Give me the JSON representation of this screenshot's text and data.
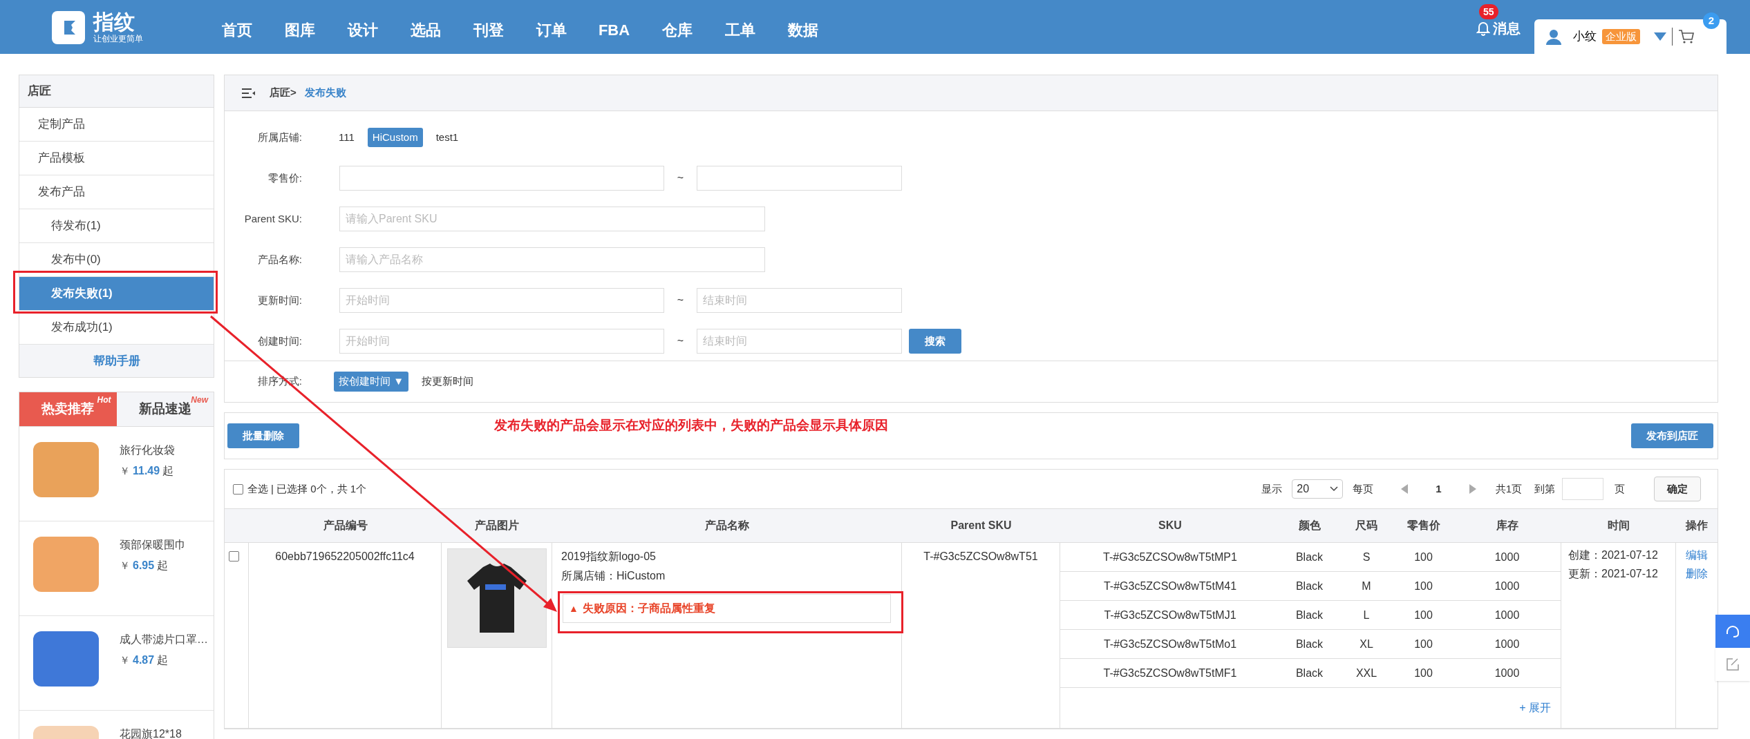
{
  "header": {
    "logo_title": "指纹",
    "logo_slogan": "让创业更简单",
    "nav": [
      {
        "label": "首页"
      },
      {
        "label": "图库"
      },
      {
        "label": "设计"
      },
      {
        "label": "选品"
      },
      {
        "label": "刊登"
      },
      {
        "label": "订单"
      },
      {
        "label": "FBA"
      },
      {
        "label": "仓库"
      },
      {
        "label": "工单"
      },
      {
        "label": "数据"
      }
    ],
    "messages": {
      "label": "消息",
      "count": "55"
    },
    "user": {
      "name": "小纹",
      "badge": "企业版"
    },
    "cart_count": "2"
  },
  "sidebar": {
    "title": "店匠",
    "items": [
      {
        "label": "定制产品",
        "selected": false
      },
      {
        "label": "产品模板",
        "selected": false
      },
      {
        "label": "发布产品",
        "selected": false,
        "children": [
          {
            "label": "待发布(1)",
            "selected": false
          },
          {
            "label": "发布中(0)",
            "selected": false
          },
          {
            "label": "发布失败(1)",
            "selected": true
          },
          {
            "label": "发布成功(1)",
            "selected": false
          }
        ]
      }
    ],
    "help": "帮助手册",
    "tabs": [
      {
        "label": "热卖推荐",
        "tag": "Hot",
        "selected": true
      },
      {
        "label": "新品速递",
        "tag": "New",
        "selected": false
      }
    ],
    "products": [
      {
        "name": "旅行化妆袋",
        "currency": "￥",
        "price": "11.49",
        "suffix": "起",
        "color": "#e9a25a"
      },
      {
        "name": "颈部保暖围巾",
        "currency": "￥",
        "price": "6.95",
        "suffix": "起",
        "color": "#f0a564"
      },
      {
        "name": "成人带滤片口罩…",
        "currency": "￥",
        "price": "4.87",
        "suffix": "起",
        "color": "#3f78d8"
      },
      {
        "name": "花园旗12*18",
        "color": "#f6d3b4"
      }
    ]
  },
  "breadcrumb": {
    "parent": "店匠>",
    "current": "发布失败"
  },
  "filters": {
    "store": {
      "label": "所属店铺:",
      "options": [
        {
          "label": "111",
          "selected": false
        },
        {
          "label": "HiCustom",
          "selected": true
        },
        {
          "label": "test1",
          "selected": false
        }
      ]
    },
    "price": {
      "label": "零售价:",
      "separator": "~"
    },
    "parent_sku": {
      "label": "Parent SKU:",
      "placeholder": "请输入Parent SKU"
    },
    "product_name": {
      "label": "产品名称:",
      "placeholder": "请输入产品名称"
    },
    "updated": {
      "label": "更新时间:",
      "from_placeholder": "开始时间",
      "separator": "~",
      "to_placeholder": "结束时间"
    },
    "created": {
      "label": "创建时间:",
      "from_placeholder": "开始时间",
      "separator": "~",
      "to_placeholder": "结束时间"
    },
    "search_button": "搜索",
    "sort": {
      "label": "排序方式:",
      "options": [
        {
          "label": "按创建时间",
          "arrow": "▼",
          "selected": true
        },
        {
          "label": "按更新时间",
          "selected": false
        }
      ]
    }
  },
  "toolbar": {
    "batch_delete": "批量删除",
    "publish": "发布到店匠"
  },
  "annotation": "发布失败的产品会显示在对应的列表中，失败的产品会显示具体原因",
  "list": {
    "select_all": {
      "label": "全选",
      "checked": false
    },
    "summary": "| 已选择 0个，共 1个",
    "pagination": {
      "show": "显示",
      "page_size": "20",
      "per_page": "每页",
      "current": "1",
      "total": "共1页",
      "goto": "到第",
      "page": "页",
      "confirm": "确定"
    },
    "columns": [
      "产品编号",
      "产品图片",
      "产品名称",
      "Parent SKU",
      "SKU",
      "颜色",
      "尺码",
      "零售价",
      "库存",
      "时间",
      "操作"
    ],
    "rows": [
      {
        "checked": false,
        "id": "60ebb719652205002ffc11c4",
        "name": "2019指纹新logo-05",
        "store": "所属店铺：HiCustom",
        "error_icon": "▲",
        "error": "失败原因：子商品属性重复",
        "parent_sku": "T-#G3c5ZCSOw8wT51",
        "variants": [
          {
            "sku": "T-#G3c5ZCSOw8wT5tMP1",
            "color_label": "Black",
            "size": "S",
            "price": "100",
            "stock": "1000"
          },
          {
            "sku": "T-#G3c5ZCSOw8wT5tM41",
            "color_label": "Black",
            "size": "M",
            "price": "100",
            "stock": "1000"
          },
          {
            "sku": "T-#G3c5ZCSOw8wT5tMJ1",
            "color_label": "Black",
            "size": "L",
            "price": "100",
            "stock": "1000"
          },
          {
            "sku": "T-#G3c5ZCSOw8wT5tMo1",
            "color_label": "Black",
            "size": "XL",
            "price": "100",
            "stock": "1000"
          },
          {
            "sku": "T-#G3c5ZCSOw8wT5tMF1",
            "color_label": "Black",
            "size": "XXL",
            "price": "100",
            "stock": "1000"
          }
        ],
        "expand": "+ 展开",
        "created": "创建：2021-07-12",
        "updated": "更新：2021-07-12",
        "actions": [
          "编辑",
          "删除"
        ]
      }
    ]
  }
}
